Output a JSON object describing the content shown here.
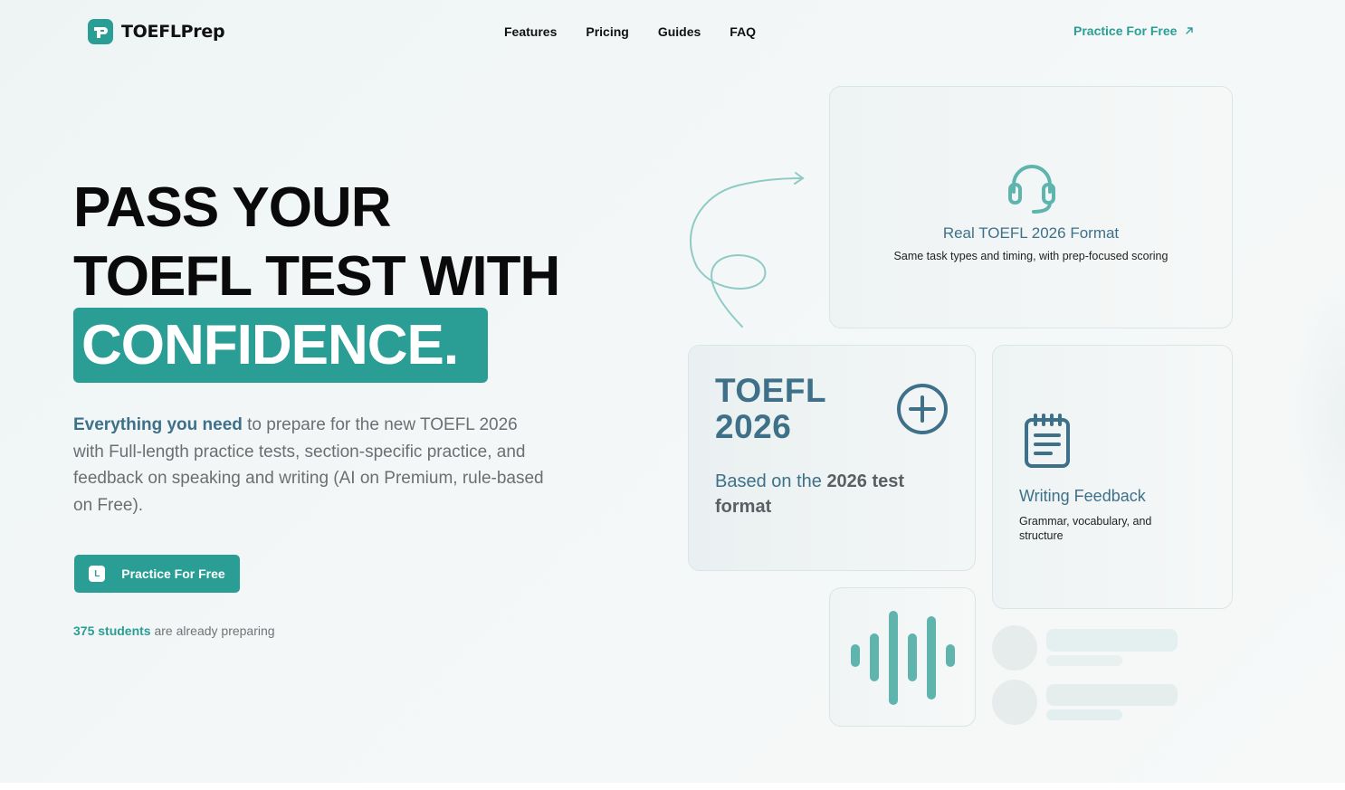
{
  "brand": {
    "name": "TOEFLPrep",
    "accent": "#2a9d94",
    "heading_color": "#3e7189"
  },
  "nav": {
    "items": [
      "Features",
      "Pricing",
      "Guides",
      "FAQ"
    ],
    "cta_label": "Practice For Free"
  },
  "hero": {
    "line1": "PASS YOUR",
    "line2": "TOEFL TEST WITH",
    "highlight": "CONFIDENCE.",
    "lead_highlight": "Everything you need",
    "lead_rest": " to prepare for the new TOEFL 2026 with Full-length practice tests, section-specific practice, and feedback on speaking and writing (AI on Premium, rule-based on Free).",
    "cta_label": "Practice For Free",
    "cta_icon_letter": "L",
    "students_count": "375 students",
    "students_rest": " are already preparing"
  },
  "cards": {
    "format": {
      "icon": "headset-icon",
      "title": "Real TOEFL 2026 Format",
      "desc": "Same task types and timing, with prep-focused scoring"
    },
    "toefl": {
      "line1": "TOEFL",
      "line2": "2026",
      "icon": "plus-circle-icon",
      "sub_prefix": "Based on the ",
      "sub_bold": "2026 test format"
    },
    "writing": {
      "icon": "notepad-icon",
      "title": "Writing Feedback",
      "desc": "Grammar, vocabulary, and structure"
    },
    "speaking": {
      "icon": "audio-wave-icon"
    }
  }
}
